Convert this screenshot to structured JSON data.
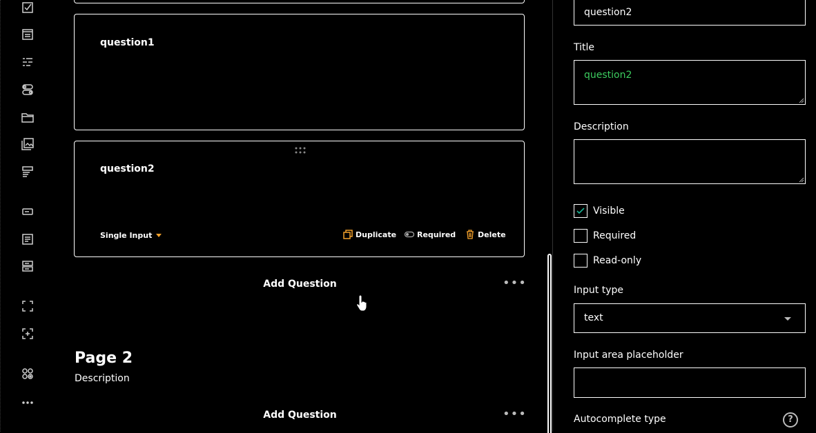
{
  "toolbox": {
    "icons": [
      "checkbox-icon",
      "comment-icon",
      "ranking-icon",
      "boolean-icon",
      "file-icon",
      "image-picker-icon",
      "multiple-text-icon",
      "single-input-icon",
      "text-area-icon",
      "panel-icon",
      "dynamic-panel-icon",
      "add-expression-icon",
      "more-tools-icon",
      "more-icon"
    ]
  },
  "canvas": {
    "question1": {
      "title": "question1"
    },
    "question2": {
      "title": "question2",
      "type_selector": "Single Input",
      "actions": {
        "duplicate": "Duplicate",
        "required": "Required",
        "delete": "Delete"
      }
    },
    "add_question_1": "Add Question",
    "page2": {
      "title": "Page 2",
      "description": "Description"
    },
    "add_question_2": "Add Question",
    "more_dots": "•••"
  },
  "properties": {
    "name_value": "question2",
    "title_label": "Title",
    "title_value": "question2",
    "description_label": "Description",
    "description_value": "",
    "checkboxes": {
      "visible": {
        "label": "Visible",
        "checked": true
      },
      "required": {
        "label": "Required",
        "checked": false
      },
      "readonly": {
        "label": "Read-only",
        "checked": false
      }
    },
    "input_type_label": "Input type",
    "input_type_value": "text",
    "placeholder_label": "Input area placeholder",
    "placeholder_value": "",
    "autocomplete_label": "Autocomplete type",
    "help_symbol": "?"
  },
  "colors": {
    "accent_orange": "#f4a12b",
    "title_green": "#3ccc5f",
    "check_green": "#1ab394"
  }
}
